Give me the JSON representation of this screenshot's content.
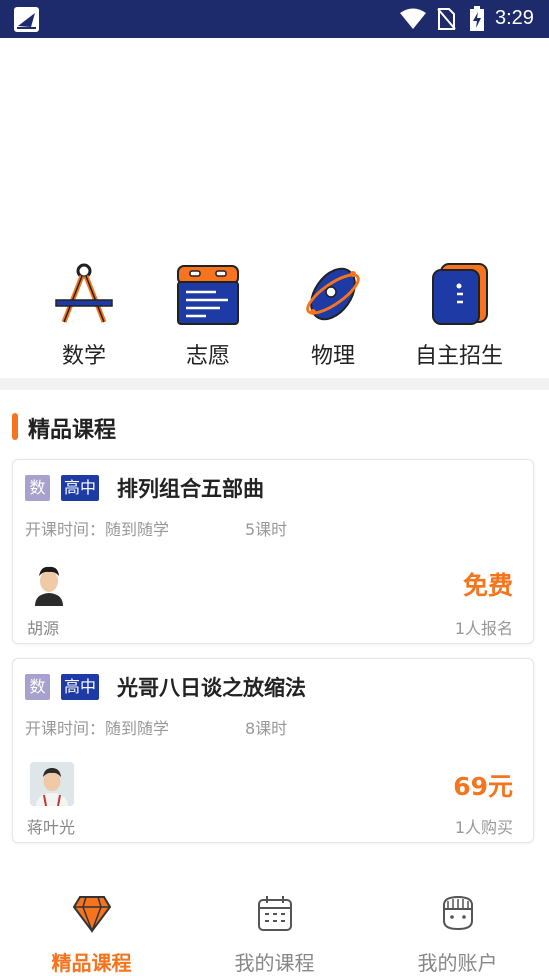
{
  "status_bar": {
    "time": "3:29"
  },
  "categories": [
    {
      "label": "数学",
      "icon": "compass-icon"
    },
    {
      "label": "志愿",
      "icon": "application-form-icon"
    },
    {
      "label": "物理",
      "icon": "atom-icon"
    },
    {
      "label": "自主招生",
      "icon": "enrollment-book-icon"
    }
  ],
  "section": {
    "title": "精品课程"
  },
  "courses": [
    {
      "subject_tag": "数",
      "level_tag": "高中",
      "title": "排列组合五部曲",
      "time_label": "开课时间：随到随学",
      "hours": "5课时",
      "teacher": "胡源",
      "price": "免费",
      "count": "1人报名"
    },
    {
      "subject_tag": "数",
      "level_tag": "高中",
      "title": "光哥八日谈之放缩法",
      "time_label": "开课时间：随到随学",
      "hours": "8课时",
      "teacher": "蒋叶光",
      "price": "69元",
      "count": "1人购买"
    }
  ],
  "bottom_nav": [
    {
      "label": "精品课程",
      "icon": "diamond-icon",
      "active": true
    },
    {
      "label": "我的课程",
      "icon": "calendar-icon",
      "active": false
    },
    {
      "label": "我的账户",
      "icon": "account-icon",
      "active": false
    }
  ],
  "colors": {
    "status_bar": "#1d2a6b",
    "accent": "#f5741d",
    "level_tag": "#1e3aa5",
    "subject_tag": "#a7a1cd"
  }
}
